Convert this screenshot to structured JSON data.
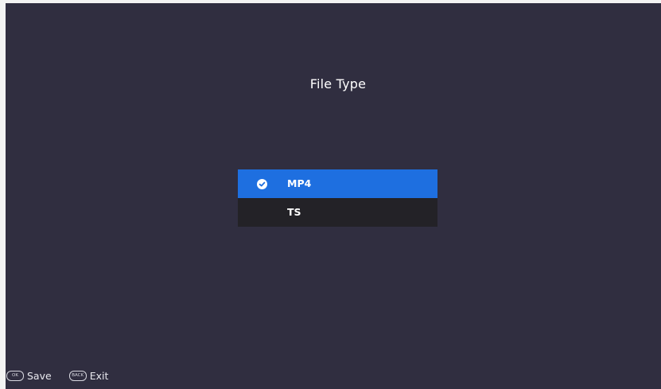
{
  "title": "File Type",
  "options": [
    {
      "label": "MP4",
      "selected": true
    },
    {
      "label": "TS",
      "selected": false
    }
  ],
  "footer": {
    "save": {
      "key": "OK",
      "label": "Save"
    },
    "exit": {
      "key": "BACK",
      "label": "Exit"
    }
  },
  "colors": {
    "background": "#302e40",
    "selected": "#1e6fe0",
    "option": "#232227"
  }
}
